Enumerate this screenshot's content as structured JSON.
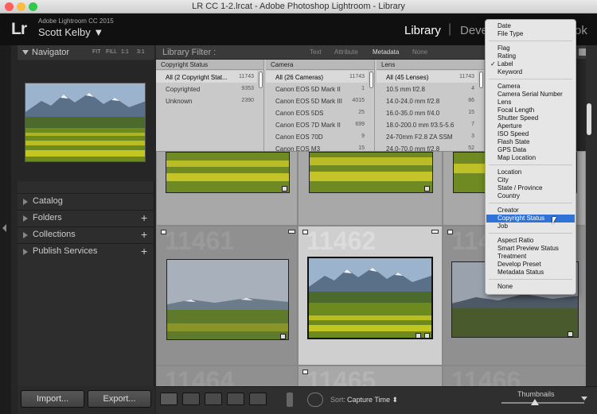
{
  "window": {
    "title": "LR CC 1-2.lrcat - Adobe Photoshop Lightroom - Library"
  },
  "identity": {
    "logo": "Lr",
    "app_name": "Adobe Lightroom CC 2015",
    "user": "Scott Kelby ▼"
  },
  "modules": {
    "library": "Library",
    "separator": "|",
    "develop": "Develo",
    "book": "ok"
  },
  "navigator": {
    "title": "Navigator",
    "zoom_options": [
      "FIT",
      "FILL",
      "1:1",
      "3:1"
    ]
  },
  "left_panels": [
    {
      "label": "Catalog",
      "has_plus": false
    },
    {
      "label": "Folders",
      "has_plus": true
    },
    {
      "label": "Collections",
      "has_plus": true
    },
    {
      "label": "Publish Services",
      "has_plus": true
    }
  ],
  "buttons": {
    "import": "Import...",
    "export": "Export..."
  },
  "library_filter": {
    "label": "Library Filter :",
    "tabs": [
      "Text",
      "Attribute",
      "Metadata",
      "None"
    ],
    "active_tab": "Metadata"
  },
  "filter_columns": [
    {
      "header": "Copyright Status",
      "rows": [
        {
          "label": "All (2 Copyright Stat...",
          "count": "11743",
          "selected": true
        },
        {
          "label": "Copyrighted",
          "count": "9353"
        },
        {
          "label": "Unknown",
          "count": "2390"
        }
      ]
    },
    {
      "header": "Camera",
      "rows": [
        {
          "label": "All (26 Cameras)",
          "count": "11743",
          "selected": true
        },
        {
          "label": "Canon EOS 5D Mark II",
          "count": "1"
        },
        {
          "label": "Canon EOS 5D Mark III",
          "count": "4015"
        },
        {
          "label": "Canon EOS 5DS",
          "count": "25"
        },
        {
          "label": "Canon EOS 7D Mark II",
          "count": "699"
        },
        {
          "label": "Canon EOS 70D",
          "count": "9"
        },
        {
          "label": "Canon EOS M3",
          "count": "15"
        }
      ]
    },
    {
      "header": "Lens",
      "rows": [
        {
          "label": "All (45 Lenses)",
          "count": "11743",
          "selected": true
        },
        {
          "label": "10.5 mm f/2.8",
          "count": "4"
        },
        {
          "label": "14.0-24.0 mm f/2.8",
          "count": "86"
        },
        {
          "label": "16.0-35.0 mm f/4.0",
          "count": "15"
        },
        {
          "label": "18.0-200.0 mm f/3.5-5.6",
          "count": "7"
        },
        {
          "label": "24-70mm F2.8 ZA SSM",
          "count": "3"
        },
        {
          "label": "24.0-70.0 mm f/2.8",
          "count": "52"
        }
      ]
    }
  ],
  "grid": {
    "cell_numbers": [
      "11461",
      "11462",
      "11463",
      "11464",
      "11465",
      "11466"
    ]
  },
  "toolbar": {
    "sort_label": "Sort:",
    "sort_value": "Capture Time ⬍",
    "thumbnails_label": "Thumbnails",
    "thumbnail_size": 0.4
  },
  "dropdown_menu": {
    "groups": [
      [
        {
          "label": "Date"
        },
        {
          "label": "File Type"
        }
      ],
      [
        {
          "label": "Flag"
        },
        {
          "label": "Rating"
        },
        {
          "label": "Label",
          "checked": true
        },
        {
          "label": "Keyword"
        }
      ],
      [
        {
          "label": "Camera"
        },
        {
          "label": "Camera Serial Number"
        },
        {
          "label": "Lens"
        },
        {
          "label": "Focal Length"
        },
        {
          "label": "Shutter Speed"
        },
        {
          "label": "Aperture"
        },
        {
          "label": "ISO Speed"
        },
        {
          "label": "Flash State"
        },
        {
          "label": "GPS Data"
        },
        {
          "label": "Map Location"
        }
      ],
      [
        {
          "label": "Location"
        },
        {
          "label": "City"
        },
        {
          "label": "State / Province"
        },
        {
          "label": "Country"
        }
      ],
      [
        {
          "label": "Creator"
        },
        {
          "label": "Copyright Status",
          "highlighted": true
        },
        {
          "label": "Job"
        }
      ],
      [
        {
          "label": "Aspect Ratio"
        },
        {
          "label": "Smart Preview Status"
        },
        {
          "label": "Treatment"
        },
        {
          "label": "Develop Preset"
        },
        {
          "label": "Metadata Status"
        }
      ],
      [
        {
          "label": "None"
        }
      ]
    ]
  },
  "colors": {
    "menu_highlight": "#2f73d8",
    "panel_bg": "#2d2d2d",
    "grid_bg": "#777777"
  }
}
